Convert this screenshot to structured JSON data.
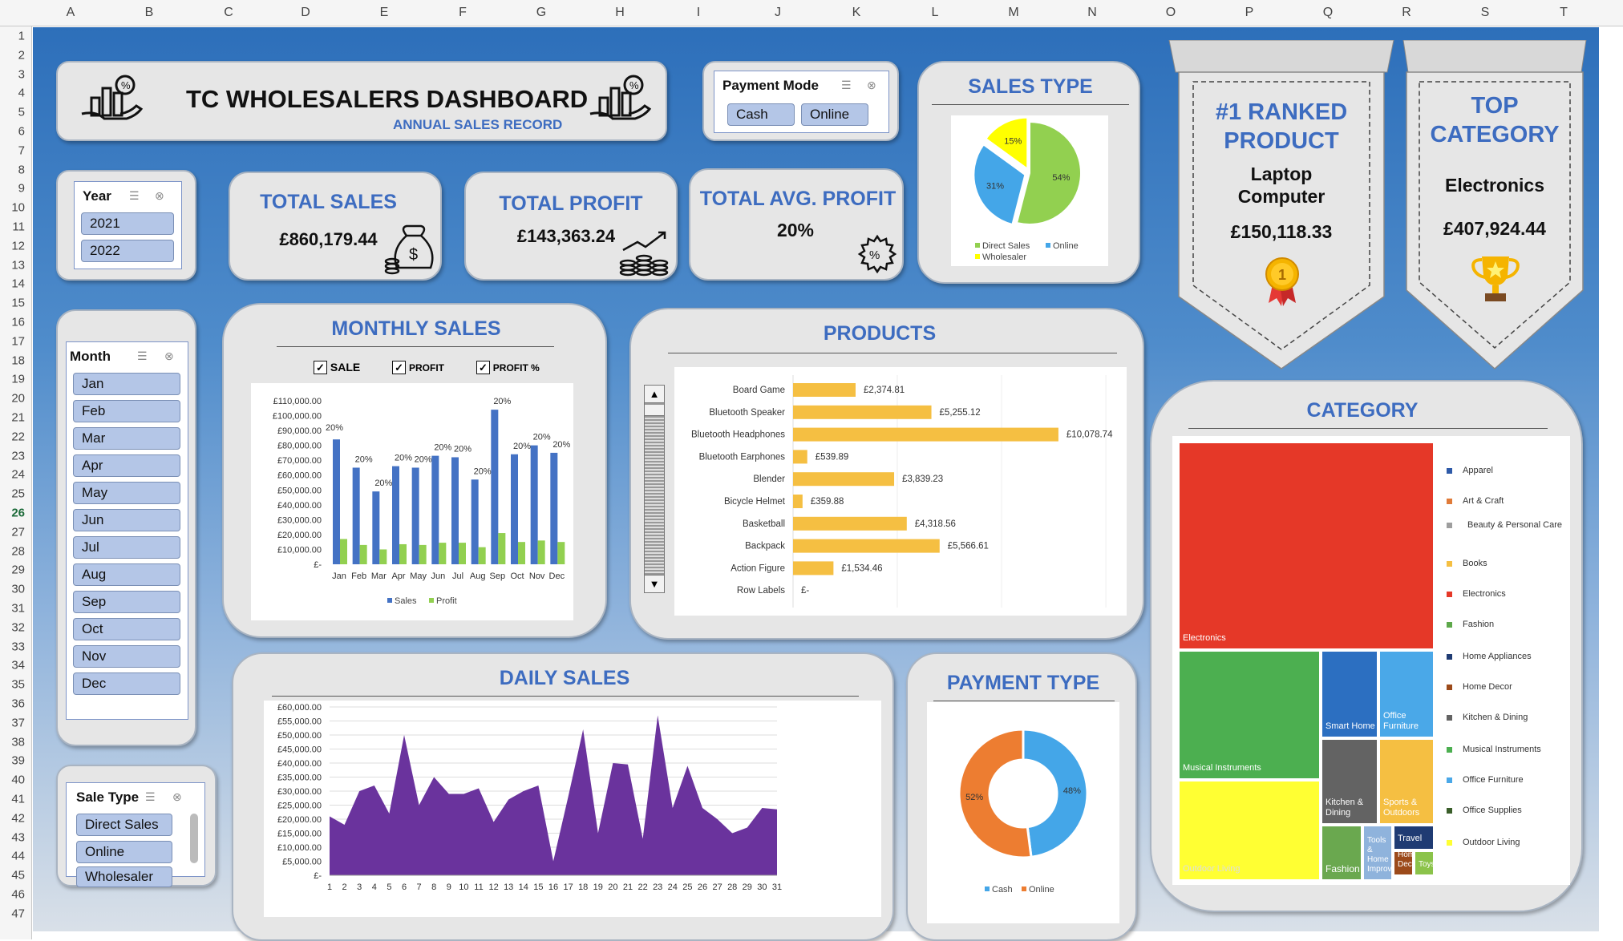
{
  "sheet": {
    "columns": [
      "A",
      "B",
      "C",
      "D",
      "E",
      "F",
      "G",
      "H",
      "I",
      "J",
      "K",
      "L",
      "M",
      "N",
      "O",
      "P",
      "Q",
      "R",
      "S",
      "T"
    ],
    "rows": [
      "1",
      "2",
      "3",
      "4",
      "5",
      "6",
      "7",
      "8",
      "9",
      "10",
      "11",
      "12",
      "13",
      "14",
      "15",
      "16",
      "17",
      "18",
      "19",
      "20",
      "21",
      "22",
      "23",
      "24",
      "25",
      "26",
      "27",
      "28",
      "29",
      "30",
      "31",
      "32",
      "33",
      "34",
      "35",
      "36",
      "37",
      "38",
      "39",
      "40",
      "41",
      "42",
      "43",
      "44",
      "45",
      "46",
      "47"
    ],
    "selected_row": "26"
  },
  "header": {
    "title": "TC WHOLESALERS DASHBOARD",
    "subtitle": "ANNUAL SALES RECORD"
  },
  "payment_mode_slicer": {
    "title": "Payment Mode",
    "items": [
      "Cash",
      "Online"
    ]
  },
  "year_slicer": {
    "title": "Year",
    "items": [
      "2021",
      "2022"
    ]
  },
  "month_slicer": {
    "title": "Month",
    "items": [
      "Jan",
      "Feb",
      "Mar",
      "Apr",
      "May",
      "Jun",
      "Jul",
      "Aug",
      "Sep",
      "Oct",
      "Nov",
      "Dec"
    ]
  },
  "sale_type_slicer": {
    "title": "Sale Type",
    "items": [
      "Direct Sales",
      "Online",
      "Wholesaler"
    ]
  },
  "kpis": {
    "total_sales_label": "TOTAL SALES",
    "total_sales": "£860,179.44",
    "total_profit_label": "TOTAL PROFIT",
    "total_profit": "£143,363.24",
    "avg_profit_label": "TOTAL AVG. PROFIT",
    "avg_profit": "20%"
  },
  "ranked": {
    "title1": "#1 RANKED",
    "title2": "PRODUCT",
    "name1": "Laptop",
    "name2": "Computer",
    "value": "£150,118.33"
  },
  "top_category": {
    "title1": "TOP",
    "title2": "CATEGORY",
    "name": "Electronics",
    "value": "£407,924.44"
  },
  "colors": {
    "blue": "#4472c4",
    "green": "#92d050",
    "yellow": "#ffff00",
    "sky": "#44a6e8",
    "orange": "#ed7d31",
    "gold": "#f5bf42",
    "purple": "#6a339d",
    "title": "#3d6cc0"
  },
  "chart_data": [
    {
      "id": "sales_type",
      "type": "pie",
      "title": "SALES TYPE",
      "labels": [
        "Direct Sales",
        "Online",
        "Wholesaler"
      ],
      "values": [
        54,
        31,
        15
      ],
      "data_labels": [
        "54%",
        "31%",
        "15%"
      ],
      "colors": [
        "#92d050",
        "#44a6e8",
        "#ffff00"
      ],
      "legend": "bottom"
    },
    {
      "id": "monthly_sales",
      "type": "bar",
      "title": "MONTHLY SALES",
      "checkboxes": [
        "SALE",
        "PROFIT",
        "PROFIT %"
      ],
      "categories": [
        "Jan",
        "Feb",
        "Mar",
        "Apr",
        "May",
        "Jun",
        "Jul",
        "Aug",
        "Sep",
        "Oct",
        "Nov",
        "Dec"
      ],
      "series": [
        {
          "name": "Sales",
          "values": [
            84000,
            65000,
            49000,
            66000,
            65000,
            73000,
            72000,
            57000,
            104000,
            74000,
            80000,
            75000
          ],
          "color": "#4472c4"
        },
        {
          "name": "Profit",
          "values": [
            17000,
            13000,
            10000,
            13500,
            13000,
            14500,
            14500,
            11500,
            21000,
            15000,
            16000,
            15000
          ],
          "color": "#92d050"
        }
      ],
      "data_labels": [
        "20%",
        "20%",
        "20%",
        "20%",
        "20%",
        "20%",
        "20%",
        "20%",
        "20%",
        "20%",
        "20%",
        "20%"
      ],
      "ylim": [
        0,
        110000
      ],
      "yticks": [
        "£-",
        "£10,000.00",
        "£20,000.00",
        "£30,000.00",
        "£40,000.00",
        "£50,000.00",
        "£60,000.00",
        "£70,000.00",
        "£80,000.00",
        "£90,000.00",
        "£100,000.00",
        "£110,000.00"
      ],
      "legend": "bottom"
    },
    {
      "id": "products",
      "type": "bar",
      "title": "PRODUCTS",
      "orientation": "horizontal",
      "categories": [
        "Board Game",
        "Bluetooth Speaker",
        "Bluetooth Headphones",
        "Bluetooth Earphones",
        "Blender",
        "Bicycle Helmet",
        "Basketball",
        "Backpack",
        "Action Figure",
        "Row Labels"
      ],
      "values": [
        2374.81,
        5255.12,
        10078.74,
        539.89,
        3839.23,
        359.88,
        4318.56,
        5566.61,
        1534.46,
        0
      ],
      "data_labels": [
        "£2,374.81",
        "£5,255.12",
        "£10,078.74",
        "£539.89",
        "£3,839.23",
        "£359.88",
        "£4,318.56",
        "£5,566.61",
        "£1,534.46",
        "£-"
      ],
      "xlim": [
        0,
        12000
      ],
      "color": "#f5bf42"
    },
    {
      "id": "category",
      "type": "heatmap",
      "subtype": "treemap",
      "title": "CATEGORY",
      "legend_items": [
        {
          "name": "Apparel",
          "color": "#2e5aa8"
        },
        {
          "name": "Art & Craft",
          "color": "#e07b39"
        },
        {
          "name": "Beauty & Personal Care",
          "color": "#9e9e9e"
        },
        {
          "name": "Books",
          "color": "#f5bf42"
        },
        {
          "name": "Electronics",
          "color": "#e53828"
        },
        {
          "name": "Fashion",
          "color": "#5da84a"
        },
        {
          "name": "Home Appliances",
          "color": "#1f3b73"
        },
        {
          "name": "Home Decor",
          "color": "#9c4a1a"
        },
        {
          "name": "Kitchen & Dining",
          "color": "#636363"
        },
        {
          "name": "Musical Instruments",
          "color": "#4caf50"
        },
        {
          "name": "Office Furniture",
          "color": "#4aa8e8"
        },
        {
          "name": "Office Supplies",
          "color": "#3a5e2a"
        },
        {
          "name": "Outdoor Living",
          "color": "#ffff33"
        }
      ],
      "tiles": [
        {
          "label": "Electronics",
          "color": "#e53828"
        },
        {
          "label": "Musical Instruments",
          "color": "#4caf50"
        },
        {
          "label": "Outdoor Living",
          "color": "#ffff33"
        },
        {
          "label": "Smart Home",
          "color": "#2c6fc1"
        },
        {
          "label": "Office Furniture",
          "color": "#4aa8e8"
        },
        {
          "label": "Kitchen & Dining",
          "color": "#636363"
        },
        {
          "label": "Sports & Outdoors",
          "color": "#f5bf42"
        },
        {
          "label": "Fashion",
          "color": "#6aa84f"
        },
        {
          "label": "Tools & Home Improvement",
          "color": "#8fb3dc"
        },
        {
          "label": "Travel",
          "color": "#1f3b73"
        },
        {
          "label": "Home Decor",
          "color": "#9c4a1a"
        },
        {
          "label": "Toys",
          "color": "#8bc34a"
        }
      ]
    },
    {
      "id": "daily_sales",
      "type": "area",
      "title": "DAILY SALES",
      "x": [
        1,
        2,
        3,
        4,
        5,
        6,
        7,
        8,
        9,
        10,
        11,
        12,
        13,
        14,
        15,
        16,
        17,
        18,
        19,
        20,
        21,
        22,
        23,
        24,
        25,
        26,
        27,
        28,
        29,
        30,
        31
      ],
      "values": [
        21000,
        18000,
        30000,
        32000,
        22000,
        50000,
        25000,
        35000,
        29000,
        29000,
        31000,
        19000,
        27000,
        30000,
        32000,
        5000,
        28000,
        52000,
        15000,
        40000,
        39500,
        13000,
        57000,
        24000,
        39000,
        24000,
        20000,
        15000,
        17000,
        24000,
        23500
      ],
      "ylim": [
        0,
        60000
      ],
      "yticks": [
        "£-",
        "£5,000.00",
        "£10,000.00",
        "£15,000.00",
        "£20,000.00",
        "£25,000.00",
        "£30,000.00",
        "£35,000.00",
        "£40,000.00",
        "£45,000.00",
        "£50,000.00",
        "£55,000.00",
        "£60,000.00"
      ],
      "color": "#6a339d"
    },
    {
      "id": "payment_type",
      "type": "pie",
      "subtype": "doughnut",
      "title": "PAYMENT TYPE",
      "labels": [
        "Cash",
        "Online"
      ],
      "values": [
        48,
        52
      ],
      "data_labels": [
        "48%",
        "52%"
      ],
      "colors": [
        "#44a6e8",
        "#ed7d31"
      ],
      "legend": "bottom"
    }
  ]
}
